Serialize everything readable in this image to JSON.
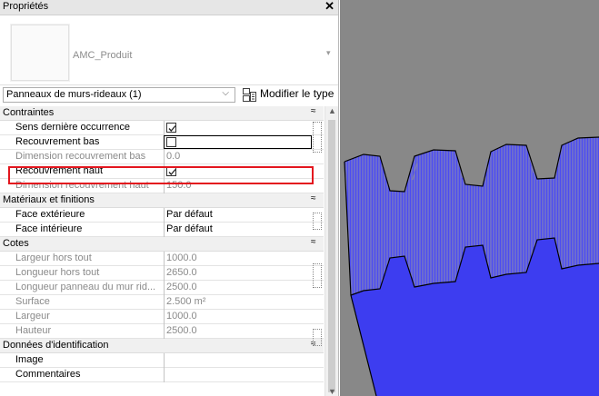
{
  "panel": {
    "title": "Propriétés",
    "close_glyph": "✕",
    "type_name": "AMC_Produit",
    "type_dropdown_glyph": "▾",
    "filter_value": "Panneaux de murs-rideaux (1)",
    "filter_arrow": "⌵",
    "edit_type_label": "Modifier le type"
  },
  "categories": [
    {
      "name": "Contraintes",
      "rows": [
        {
          "name": "Sens dernière occurrence",
          "type": "checkbox",
          "checked": true,
          "disabled": false
        },
        {
          "name": "Recouvrement bas",
          "type": "checkbox",
          "checked": false,
          "disabled": false
        },
        {
          "name": "Dimension recouvrement bas",
          "value": "0.0",
          "disabled": true
        },
        {
          "name": "Recouvrement haut",
          "type": "checkbox",
          "checked": true,
          "disabled": false,
          "highlight": true
        },
        {
          "name": "Dimension recouvrement haut",
          "value": "150.0",
          "disabled": true
        }
      ]
    },
    {
      "name": "Matériaux et finitions",
      "rows": [
        {
          "name": "Face extérieure",
          "value": "Par défaut",
          "disabled": false
        },
        {
          "name": "Face intérieure",
          "value": "Par défaut",
          "disabled": false
        }
      ]
    },
    {
      "name": "Cotes",
      "rows": [
        {
          "name": "Largeur hors tout",
          "value": "1000.0",
          "disabled": true
        },
        {
          "name": "Longueur hors tout",
          "value": "2650.0",
          "disabled": true
        },
        {
          "name": "Longueur panneau du mur rid...",
          "value": "2500.0",
          "disabled": true
        },
        {
          "name": "Surface",
          "value": "2.500 m²",
          "disabled": true
        },
        {
          "name": "Largeur",
          "value": "1000.0",
          "disabled": true
        },
        {
          "name": "Hauteur",
          "value": "2500.0",
          "disabled": true
        }
      ]
    },
    {
      "name": "Données d'identification",
      "rows": [
        {
          "name": "Image",
          "value": "",
          "disabled": false
        },
        {
          "name": "Commentaires",
          "value": "",
          "disabled": false
        }
      ]
    }
  ],
  "collapse_glyph": "≈",
  "scroll_up_glyph": "▲",
  "scroll_down_glyph": "▼",
  "colors": {
    "highlight": "#e3161e",
    "viewport_bg": "#888888",
    "panel_blue": "#3d3df0"
  }
}
